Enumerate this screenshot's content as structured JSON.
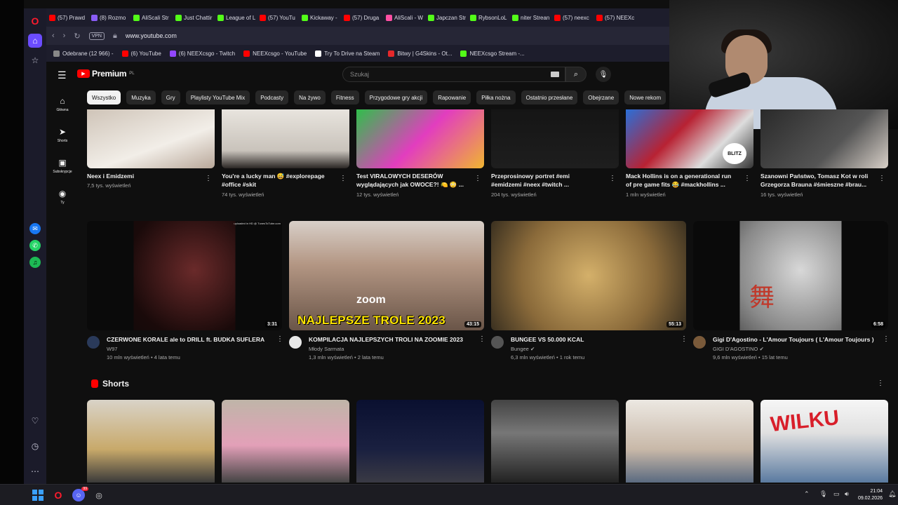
{
  "browser": {
    "tabs": [
      {
        "label": "(57) Prawd",
        "fav": "yt"
      },
      {
        "label": "(8) Rozmo",
        "fav": "purple"
      },
      {
        "label": "AliScali Str",
        "fav": "kick"
      },
      {
        "label": "Just Chattir",
        "fav": "kick"
      },
      {
        "label": "League of L",
        "fav": "kick"
      },
      {
        "label": "(57) YouTu",
        "fav": "yt"
      },
      {
        "label": "Kickaway -",
        "fav": "kick"
      },
      {
        "label": "(57) Druga",
        "fav": "yt"
      },
      {
        "label": "AliScali - W",
        "fav": "pink"
      },
      {
        "label": "Japczan Str",
        "fav": "kick"
      },
      {
        "label": "RybsonLoL",
        "fav": "kick"
      },
      {
        "label": "niter Strean",
        "fav": "kick"
      },
      {
        "label": "(57) neexc",
        "fav": "yt"
      },
      {
        "label": "(57) NEEXc",
        "fav": "yt"
      }
    ],
    "vpn_label": "VPN",
    "url": "www.youtube.com",
    "bookmarks": [
      {
        "label": "Odebrane (12 966) -",
        "fav": "gray"
      },
      {
        "label": "(6) YouTube",
        "fav": "yt"
      },
      {
        "label": "(6) NEEXcsgo - Twitch",
        "fav": "twitch"
      },
      {
        "label": "NEEXcsgo - YouTube",
        "fav": "yt"
      },
      {
        "label": "Try To Drive na Steam",
        "fav": "check"
      },
      {
        "label": "Bitwy | G4Skins - Ot...",
        "fav": "ali"
      },
      {
        "label": "NEEXcsgo Stream -...",
        "fav": "kick"
      }
    ]
  },
  "youtube": {
    "logo_text": "Premium",
    "logo_country": "PL",
    "search_placeholder": "Szukaj",
    "chips": [
      "Wszystko",
      "Muzyka",
      "Gry",
      "Playlisty YouTube Mix",
      "Podcasty",
      "Na żywo",
      "Fitness",
      "Przygodowe gry akcji",
      "Rapowanie",
      "Piłka nożna",
      "Ostatnio przesłane",
      "Obejrzane",
      "Nowe rekom"
    ],
    "nav": [
      {
        "label": "Główna",
        "icon": "home-icon",
        "glyph": "⌂"
      },
      {
        "label": "Shorts",
        "icon": "shorts-icon",
        "glyph": "➤"
      },
      {
        "label": "Subskrypcje",
        "icon": "subscriptions-icon",
        "glyph": "▣"
      },
      {
        "label": "Ty",
        "icon": "you-icon",
        "glyph": "◉"
      }
    ],
    "top_row": [
      {
        "title": "Neex i Emidzemi",
        "title2": "",
        "meta": "7,5 tys. wyświetleń"
      },
      {
        "title": "You're a lucky man 😅 #explorepage",
        "title2": "#office #skit",
        "meta": "74 tys. wyświetleń"
      },
      {
        "title": "Test VIRALOWYCH DESERÓW",
        "title2": "wyglądających jak OWOCE?! 🍋 😳 ...",
        "meta": "12 tys. wyświetleń"
      },
      {
        "title": "Przeprosinowy portret #emi",
        "title2": "#emidzemi #neex #twitch ...",
        "meta": "204 tys. wyświetleń"
      },
      {
        "title": "Mack Hollins is on a generational run",
        "title2": "of pre game fits 😂 #mackhollins ...",
        "meta": "1 mln wyświetleń"
      },
      {
        "title": "Szanowni Państwo, Tomasz Kot w roli",
        "title2": "Grzegorza Brauna #śmieszne #brau...",
        "meta": "16 tys. wyświetleń"
      }
    ],
    "main_row": [
      {
        "title": "CZERWONE KORALE ale to DRILL ft. BUDKA SUFLERA",
        "channel": "W97",
        "meta": "10 mln wyświetleń • 4 lata temu",
        "duration": "3:31",
        "overlay": "uploaded in HD @ TunesToTube.com"
      },
      {
        "title": "KOMPILACJA NAJLEPSZYCH TROLI NA ZOOMIE 2023",
        "channel": "Młody Sarmata",
        "meta": "1,3 mln wyświetleń • 2 lata temu",
        "duration": "43:15",
        "overlay": "NAJLEPSZE TROLE 2023",
        "zoom": "zoom"
      },
      {
        "title": "BUNGEE VS 50.000 KCAL",
        "channel": "Bungee ✔",
        "meta": "6,3 mln wyświetleń • 1 rok temu",
        "duration": "55:13"
      },
      {
        "title": "Gigi D'Agostino - L'Amour Toujours ( L'Amour Toujours )",
        "channel": "GIGI D'AGOSTINO ✔",
        "meta": "9,6 mln wyświetleń • 15 lat temu",
        "duration": "6:58",
        "overlay": "舞"
      }
    ],
    "shorts_title": "Shorts",
    "shorts_overlay": "WILKU",
    "top_overlay_blitz": "BLITZ"
  },
  "taskbar": {
    "time": "21:04",
    "date": "09.02.2026",
    "badge": "99"
  }
}
